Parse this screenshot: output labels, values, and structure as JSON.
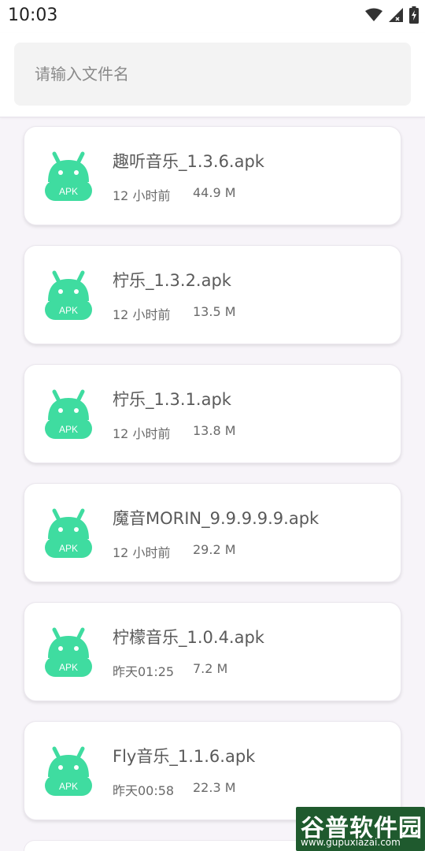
{
  "status_bar": {
    "time": "10:03"
  },
  "search": {
    "placeholder": "请输入文件名",
    "value": ""
  },
  "colors": {
    "apk_icon": "#3fdca0",
    "apk_label": "#ffffff",
    "watermark_bg": "#1f5a2e"
  },
  "apk_icon_label": "APK",
  "files": [
    {
      "name": "趣听音乐_1.3.6.apk",
      "time": "12 小时前",
      "size": "44.9 M"
    },
    {
      "name": "柠乐_1.3.2.apk",
      "time": "12 小时前",
      "size": "13.5 M"
    },
    {
      "name": "柠乐_1.3.1.apk",
      "time": "12 小时前",
      "size": "13.8 M"
    },
    {
      "name": "魔音MORIN_9.9.9.9.9.apk",
      "time": "12 小时前",
      "size": "29.2 M"
    },
    {
      "name": "柠檬音乐_1.0.4.apk",
      "time": "昨天01:25",
      "size": "7.2 M"
    },
    {
      "name": "Fly音乐_1.1.6.apk",
      "time": "昨天00:58",
      "size": "22.3 M"
    }
  ],
  "watermark": {
    "title": "谷普软件园",
    "url": "www.gupuxiazai.com"
  }
}
